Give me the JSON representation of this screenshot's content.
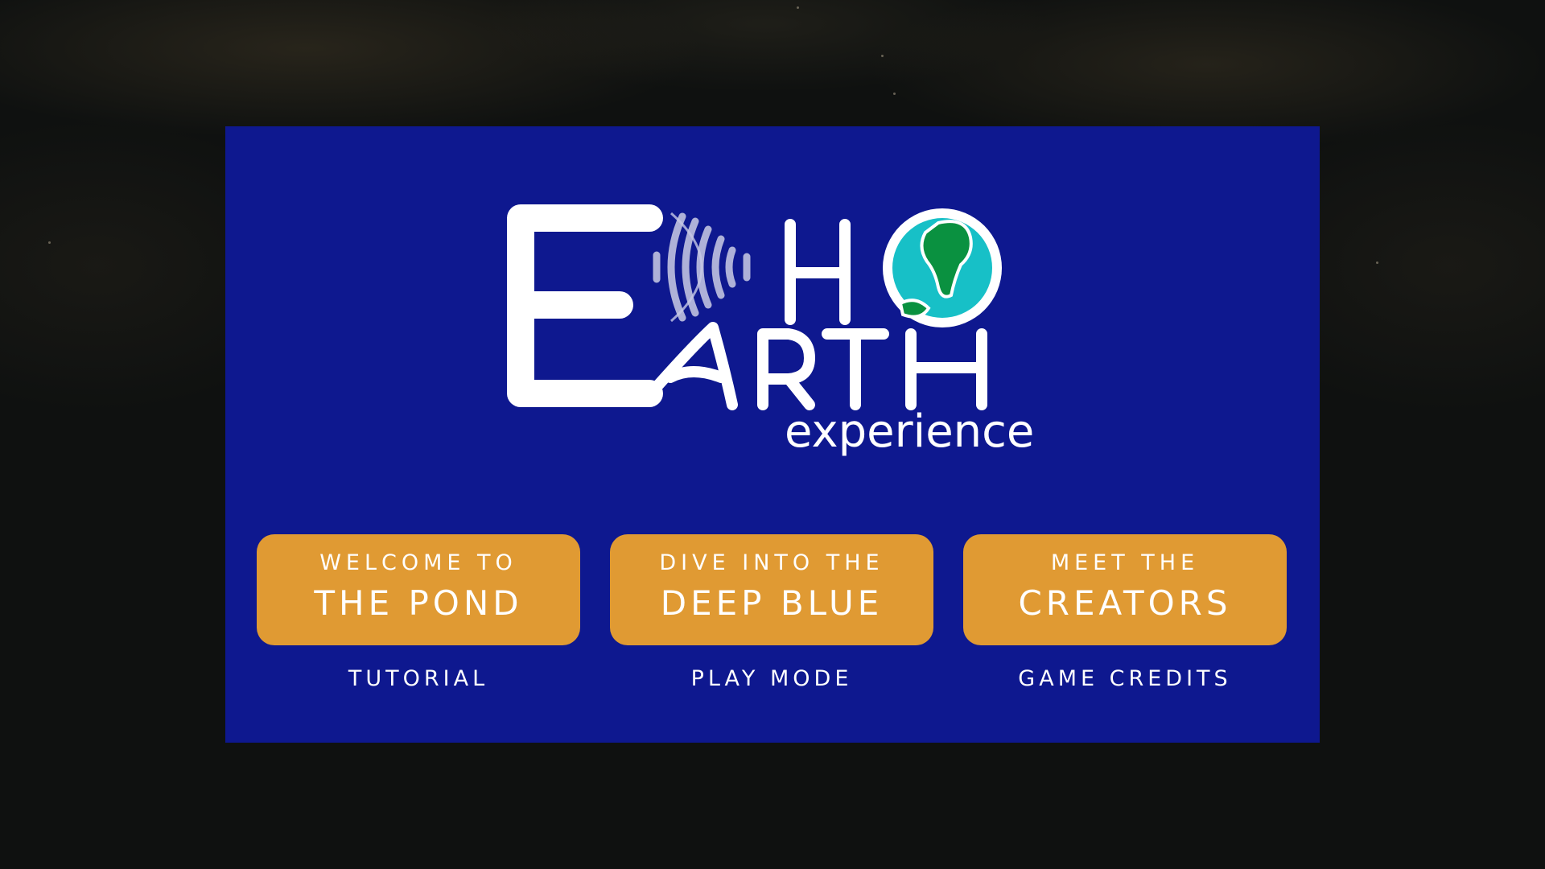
{
  "title": {
    "logo_word_1": "ECHO",
    "logo_word_2": "EARTH",
    "logo_word_3": "experience"
  },
  "menu": [
    {
      "line1": "WELCOME TO",
      "line2": "THE POND",
      "caption": "TUTORIAL"
    },
    {
      "line1": "DIVE INTO THE",
      "line2": "DEEP BLUE",
      "caption": "PLAY MODE"
    },
    {
      "line1": "MEET THE",
      "line2": "CREATORS",
      "caption": "GAME CREDITS"
    }
  ],
  "colors": {
    "panel": "#0e188f",
    "button": "#e09a33",
    "text": "#ffffff",
    "ocean": "#17c0c7",
    "land": "#0a9140",
    "background": "#0f1110"
  },
  "icons": {
    "sound_waves": "sound-waves-icon",
    "globe": "globe-icon"
  }
}
